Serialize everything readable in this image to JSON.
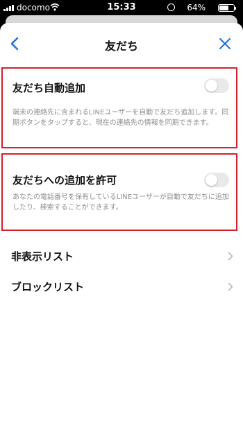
{
  "status_bar": {
    "carrier": "docomo",
    "time": "15:33",
    "battery_percent": "64%",
    "battery_level": 0.64,
    "icons": [
      "signal-icon",
      "wifi-icon",
      "rotation-lock-icon",
      "battery-icon"
    ]
  },
  "nav": {
    "title": "友だち",
    "back_icon": "chevron-left-icon",
    "close_icon": "close-icon"
  },
  "settings": [
    {
      "label": "友だち自動追加",
      "toggle_on": false,
      "description": "端末の連絡先に含まれるLINEユーザーを自動で友だち追加します。同期ボタンをタップすると、現在の連絡先の情報を同期できます。"
    },
    {
      "label": "友だちへの追加を許可",
      "toggle_on": false,
      "description": "あなたの電話番号を保有しているLINEユーザーが自動で友だちに追加したり、検索することができます。"
    }
  ],
  "list_items": [
    {
      "label": "非表示リスト"
    },
    {
      "label": "ブロックリスト"
    }
  ],
  "colors": {
    "accent": "#1a6fd6",
    "highlight_border": "#d4202a",
    "toggle_off": "#e9e9eb"
  }
}
